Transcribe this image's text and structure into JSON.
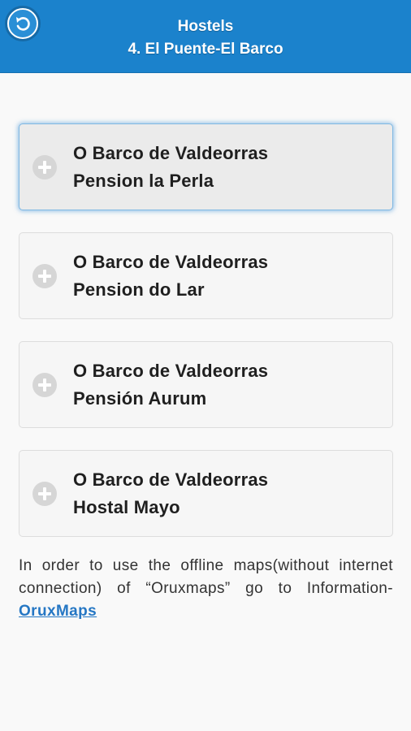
{
  "header": {
    "title_line1": "Hostels",
    "title_line2": "4. El Puente-El Barco",
    "back_icon": "back-arrow-icon"
  },
  "items": [
    {
      "line1": "O Barco de Valdeorras",
      "line2": "Pension la Perla",
      "icon": "plus-circle-icon"
    },
    {
      "line1": "O Barco de Valdeorras",
      "line2": "Pension do Lar",
      "icon": "plus-circle-icon"
    },
    {
      "line1": "O Barco de Valdeorras",
      "line2": "Pensión Aurum",
      "icon": "plus-circle-icon"
    },
    {
      "line1": "O Barco de Valdeorras",
      "line2": "Hostal Mayo",
      "icon": "plus-circle-icon"
    }
  ],
  "info": {
    "text": "In order to use the offline maps(without internet connection) of “Oruxmaps” go to Information-",
    "link_label": "OruxMaps"
  },
  "colors": {
    "header_bg": "#1b82cc",
    "link": "#2577c4",
    "active_border": "#7fb8e3"
  }
}
